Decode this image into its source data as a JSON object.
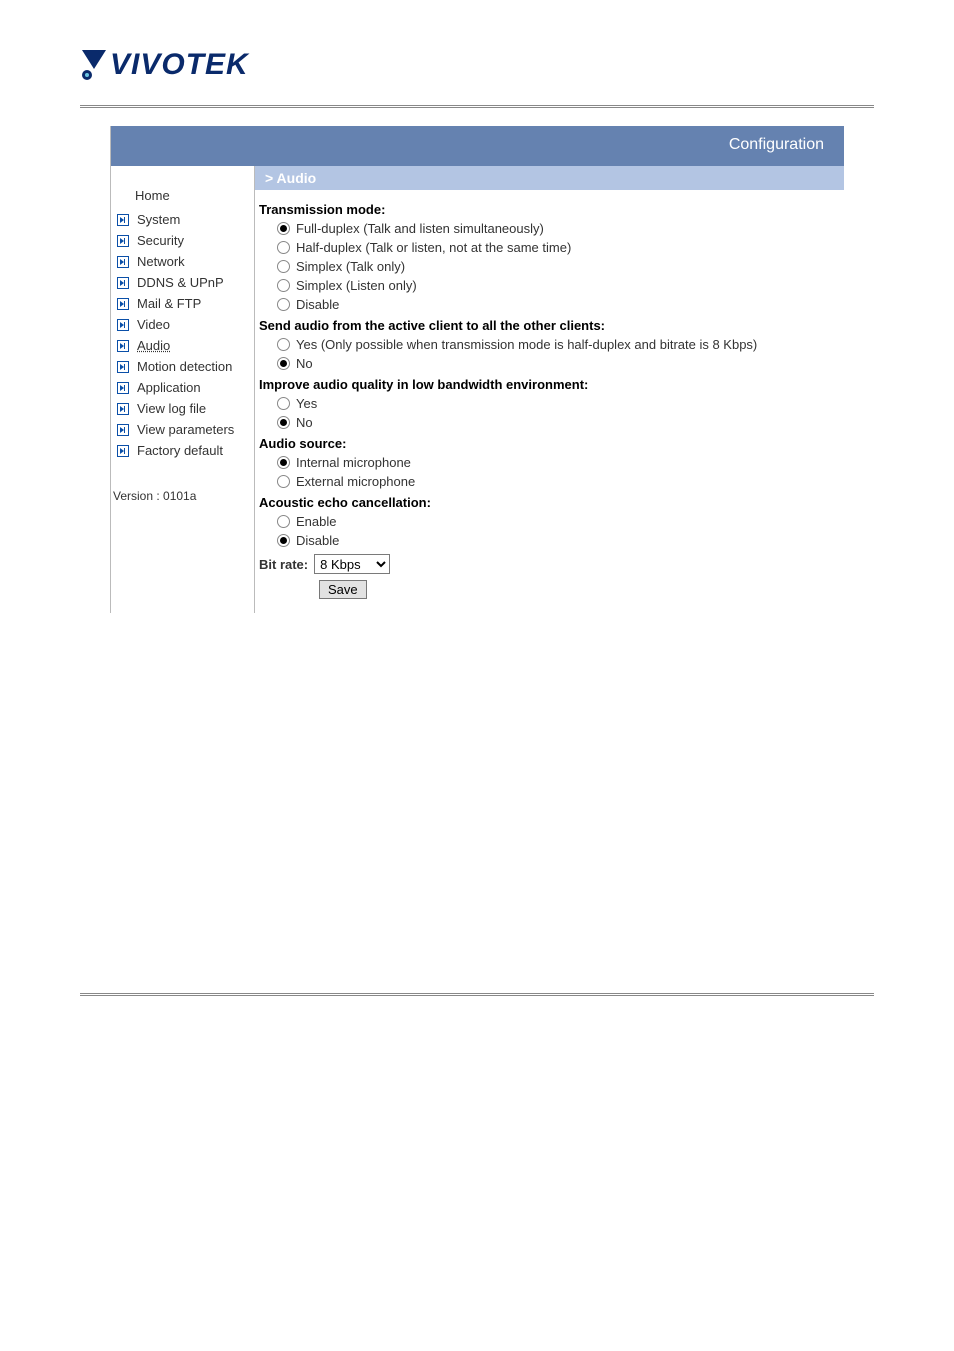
{
  "logo": {
    "text": "VIVOTEK"
  },
  "header": {
    "title": "Configuration"
  },
  "sidebar": {
    "home": "Home",
    "items": [
      {
        "label": "System"
      },
      {
        "label": "Security"
      },
      {
        "label": "Network"
      },
      {
        "label": "DDNS & UPnP"
      },
      {
        "label": "Mail & FTP"
      },
      {
        "label": "Video"
      },
      {
        "label": "Audio",
        "active": true
      },
      {
        "label": "Motion detection"
      },
      {
        "label": "Application"
      },
      {
        "label": "View log file"
      },
      {
        "label": "View parameters"
      },
      {
        "label": "Factory default"
      }
    ],
    "version": "Version : 0101a"
  },
  "breadcrumb": "> Audio",
  "sections": {
    "transmission": {
      "heading": "Transmission mode:",
      "options": [
        {
          "label": "Full-duplex (Talk and listen simultaneously)",
          "checked": true
        },
        {
          "label": "Half-duplex (Talk or listen, not at the same time)",
          "checked": false
        },
        {
          "label": "Simplex (Talk only)",
          "checked": false
        },
        {
          "label": "Simplex (Listen only)",
          "checked": false
        },
        {
          "label": "Disable",
          "checked": false
        }
      ]
    },
    "send_audio": {
      "heading": "Send audio from the active client to all the other clients:",
      "options": [
        {
          "label": "Yes (Only possible when transmission mode is half-duplex and bitrate is 8 Kbps)",
          "checked": false
        },
        {
          "label": "No",
          "checked": true
        }
      ]
    },
    "improve": {
      "heading": "Improve audio quality in low bandwidth environment:",
      "options": [
        {
          "label": "Yes",
          "checked": false
        },
        {
          "label": "No",
          "checked": true
        }
      ]
    },
    "source": {
      "heading": "Audio source:",
      "options": [
        {
          "label": "Internal microphone",
          "checked": true
        },
        {
          "label": "External microphone",
          "checked": false
        }
      ]
    },
    "echo": {
      "heading": "Acoustic echo cancellation:",
      "options": [
        {
          "label": "Enable",
          "checked": false
        },
        {
          "label": "Disable",
          "checked": true
        }
      ]
    },
    "bitrate": {
      "label": "Bit rate:",
      "value": "8 Kbps"
    }
  },
  "buttons": {
    "save": "Save"
  }
}
